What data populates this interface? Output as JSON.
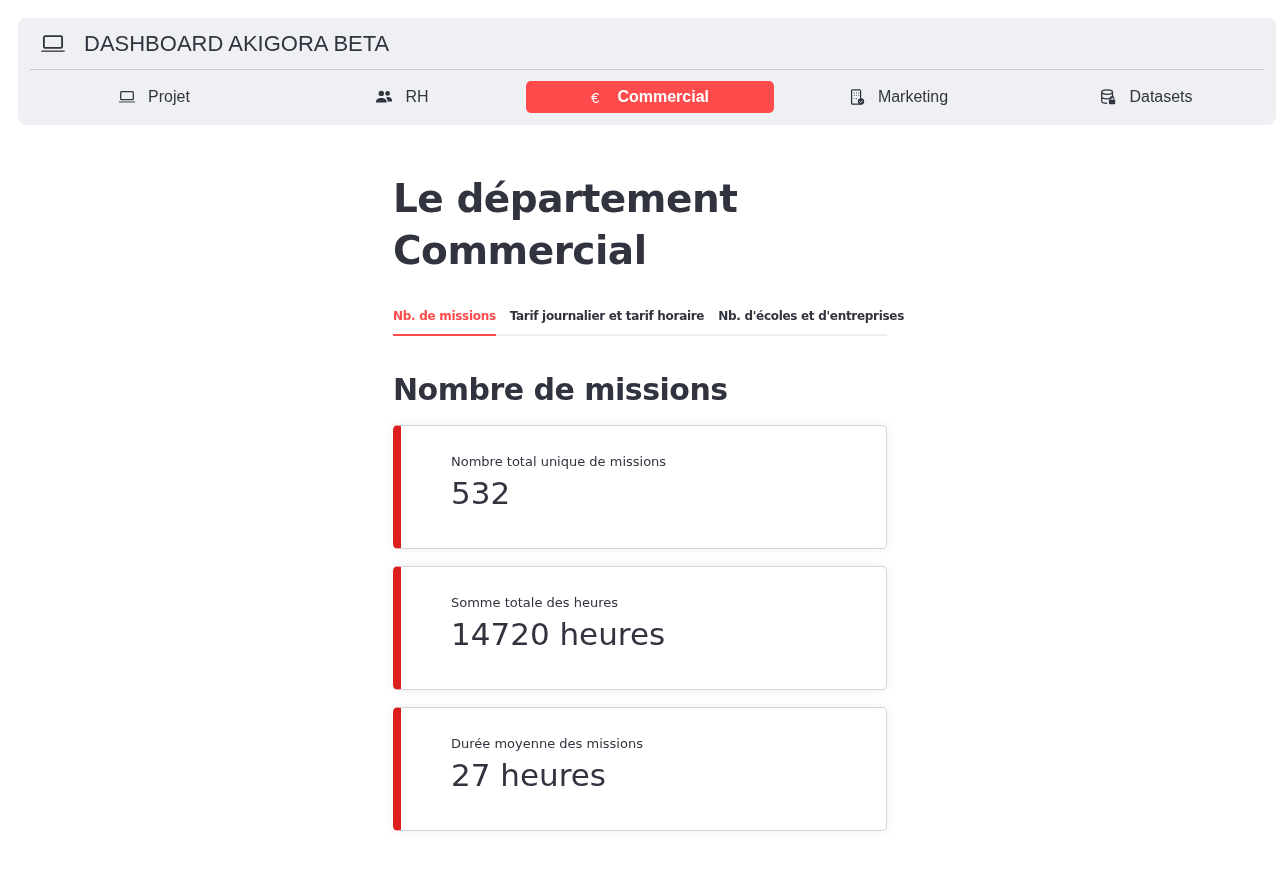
{
  "header": {
    "title": "DASHBOARD AKIGORA BETA"
  },
  "nav": [
    {
      "label": "Projet",
      "kind": "laptop",
      "selected": false
    },
    {
      "label": "RH",
      "kind": "people",
      "selected": false
    },
    {
      "label": "Commercial",
      "kind": "symbol",
      "symbol": "€",
      "selected": true
    },
    {
      "label": "Marketing",
      "kind": "building",
      "selected": false
    },
    {
      "label": "Datasets",
      "kind": "database",
      "selected": false
    }
  ],
  "page": {
    "title": "Le département Commercial"
  },
  "tabs": [
    {
      "label": "Nb. de missions",
      "selected": true
    },
    {
      "label": "Tarif journalier et tarif horaire",
      "selected": false
    },
    {
      "label": "Nb. d'écoles et d'entreprises",
      "selected": false
    }
  ],
  "section": {
    "title": "Nombre de missions"
  },
  "metrics": [
    {
      "label": "Nombre total unique de missions",
      "value": "532"
    },
    {
      "label": "Somme totale des heures",
      "value": "14720 heures"
    },
    {
      "label": "Durée moyenne des missions",
      "value": "27 heures"
    }
  ]
}
